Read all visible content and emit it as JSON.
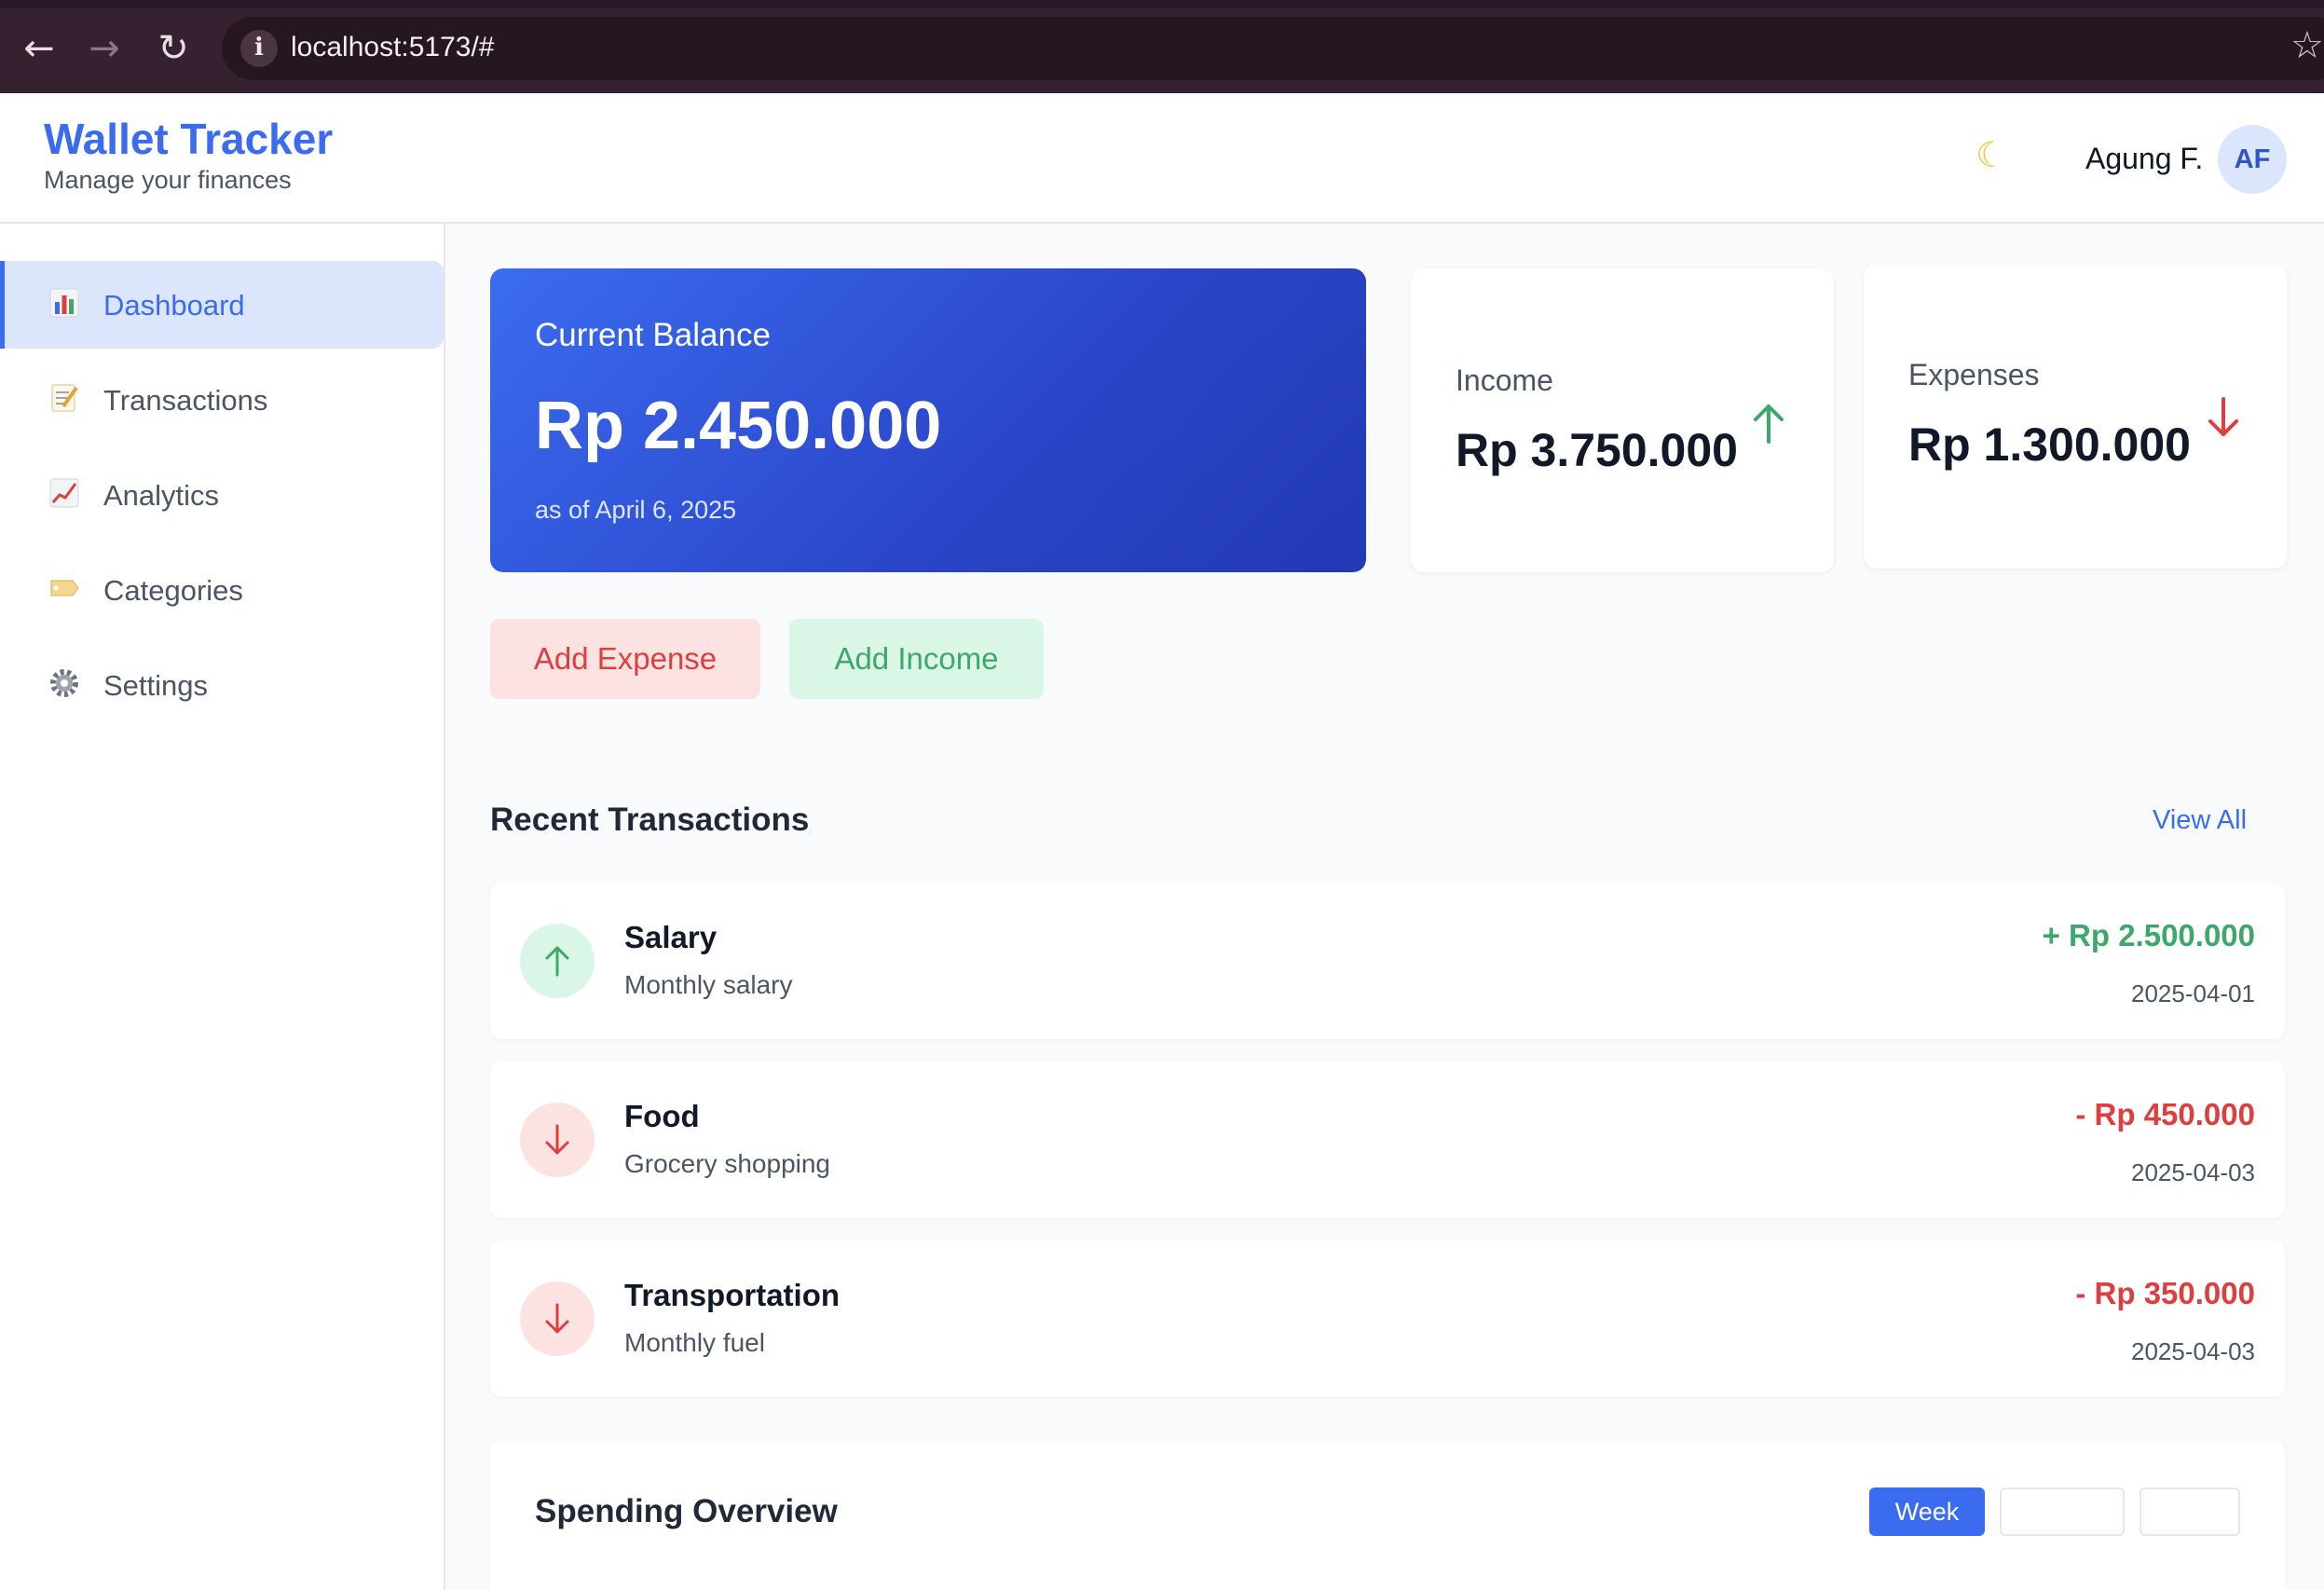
{
  "browser": {
    "url": "localhost:5173/#"
  },
  "header": {
    "title": "Wallet Tracker",
    "subtitle": "Manage your finances",
    "theme_icon": "moon-icon",
    "user_name": "Agung F.",
    "avatar_initials": "AF"
  },
  "sidebar": {
    "items": [
      {
        "label": "Dashboard",
        "icon": "bar-chart-icon",
        "active": true
      },
      {
        "label": "Transactions",
        "icon": "memo-icon",
        "active": false
      },
      {
        "label": "Analytics",
        "icon": "line-chart-icon",
        "active": false
      },
      {
        "label": "Categories",
        "icon": "tag-icon",
        "active": false
      },
      {
        "label": "Settings",
        "icon": "gear-icon",
        "active": false
      }
    ]
  },
  "balance": {
    "label": "Current Balance",
    "value": "Rp 2.450.000",
    "as_of": "as of April 6, 2025"
  },
  "income": {
    "label": "Income",
    "value": "Rp 3.750.000"
  },
  "expenses": {
    "label": "Expenses",
    "value": "Rp 1.300.000"
  },
  "actions": {
    "add_expense": "Add Expense",
    "add_income": "Add Income"
  },
  "recent": {
    "title": "Recent Transactions",
    "view_all": "View All",
    "transactions": [
      {
        "title": "Salary",
        "description": "Monthly salary",
        "amount": "+ Rp 2.500.000",
        "date": "2025-04-01",
        "type": "income"
      },
      {
        "title": "Food",
        "description": "Grocery shopping",
        "amount": "- Rp 450.000",
        "date": "2025-04-03",
        "type": "expense"
      },
      {
        "title": "Transportation",
        "description": "Monthly fuel",
        "amount": "- Rp 350.000",
        "date": "2025-04-03",
        "type": "expense"
      }
    ]
  },
  "overview": {
    "title": "Spending Overview",
    "periods": [
      "Week",
      "",
      ""
    ]
  },
  "colors": {
    "primary": "#3b6cf0",
    "income": "#3ea86b",
    "expense": "#dc3f3f"
  }
}
